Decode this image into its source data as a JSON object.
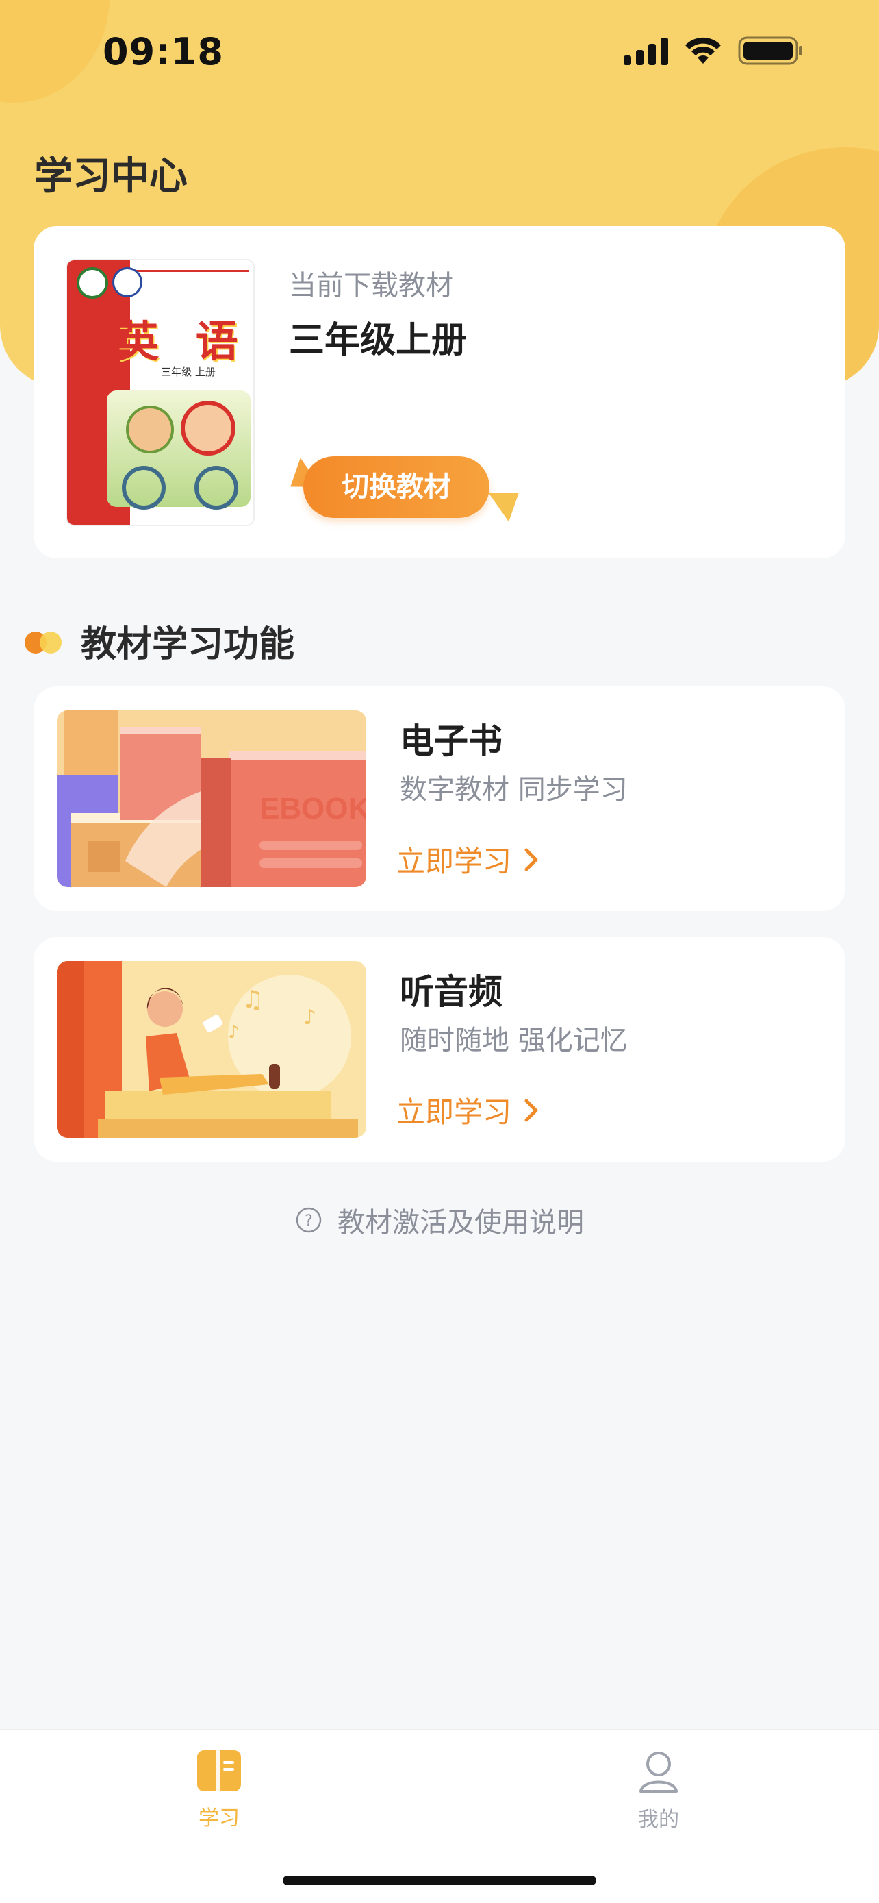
{
  "status_bar": {
    "time": "09:18",
    "signal_icon": "cellular-signal-icon",
    "wifi_icon": "wifi-icon",
    "battery_icon": "battery-icon"
  },
  "page": {
    "title": "学习中心"
  },
  "current_book": {
    "caption": "当前下载教材",
    "name": "三年级上册",
    "switch_label": "切换教材",
    "cover": {
      "subject": "英 语",
      "grade_label": "三年级 上册"
    }
  },
  "section": {
    "title": "教材学习功能"
  },
  "features": [
    {
      "title": "电子书",
      "subtitle": "数字教材 同步学习",
      "action": "立即学习",
      "thumb_text": "EBOOK",
      "icon": "chevron-right-icon"
    },
    {
      "title": "听音频",
      "subtitle": "随时随地 强化记忆",
      "action": "立即学习",
      "icon": "chevron-right-icon"
    }
  ],
  "help": {
    "text": "教材激活及使用说明",
    "icon": "question-circle-icon"
  },
  "tabbar": {
    "tabs": [
      {
        "label": "学习",
        "icon": "book-icon",
        "active": true
      },
      {
        "label": "我的",
        "icon": "user-icon",
        "active": false
      }
    ]
  },
  "colors": {
    "header": "#f8d26a",
    "accent": "#ef8a28",
    "tab_active": "#f5b63f",
    "background": "#f6f7f9"
  }
}
